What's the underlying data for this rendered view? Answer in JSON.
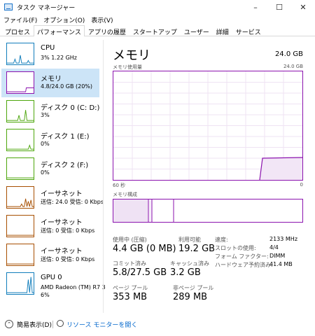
{
  "window": {
    "title": "タスク マネージャー",
    "controls": {
      "minimize": "–",
      "maximize": "☐",
      "close": "✕"
    }
  },
  "menu": [
    "ファイル(F)",
    "オプション(O)",
    "表示(V)"
  ],
  "tabs": [
    "プロセス",
    "パフォーマンス",
    "アプリの履歴",
    "スタートアップ",
    "ユーザー",
    "詳細",
    "サービス"
  ],
  "active_tab_index": 1,
  "sidebar": {
    "items": [
      {
        "name": "CPU",
        "sub": "3%  1.22 GHz",
        "sub2": "",
        "color": "#117dbb",
        "selected": false
      },
      {
        "name": "メモリ",
        "sub": "4.8/24.0 GB (20%)",
        "sub2": "",
        "color": "#8b12ae",
        "selected": true
      },
      {
        "name": "ディスク 0 (C: D:)",
        "sub": "3%",
        "sub2": "",
        "color": "#4da60c",
        "selected": false
      },
      {
        "name": "ディスク 1 (E:)",
        "sub": "0%",
        "sub2": "",
        "color": "#4da60c",
        "selected": false
      },
      {
        "name": "ディスク 2 (F:)",
        "sub": "0%",
        "sub2": "",
        "color": "#4da60c",
        "selected": false
      },
      {
        "name": "イーサネット",
        "sub": "送信: 24.0 受信: 0 Kbps",
        "sub2": "",
        "color": "#a74f01",
        "selected": false
      },
      {
        "name": "イーサネット",
        "sub": "送信: 0 受信: 0 Kbps",
        "sub2": "",
        "color": "#a74f01",
        "selected": false
      },
      {
        "name": "イーサネット",
        "sub": "送信: 0 受信: 0 Kbps",
        "sub2": "",
        "color": "#a74f01",
        "selected": false
      },
      {
        "name": "GPU 0",
        "sub": "AMD Radeon (TM) R7 3",
        "sub2": "6%",
        "color": "#117dbb",
        "selected": false
      }
    ]
  },
  "main": {
    "title": "メモリ",
    "total": "24.0 GB",
    "usage_label": "メモリ使用量",
    "usage_max": "24.0 GB",
    "time_label": "60 秒",
    "zero_label": "0",
    "composition_label": "メモリ構成",
    "accent_color": "#8b12ae"
  },
  "stats": {
    "in_use_label": "使用中 (圧縮)",
    "in_use_value": "4.4 GB (0 MB)",
    "available_label": "利用可能",
    "available_value": "19.2 GB",
    "committed_label": "コミット済み",
    "committed_value": "5.8/27.5 GB",
    "cached_label": "キャッシュ済み",
    "cached_value": "3.2 GB",
    "paged_label": "ページ プール",
    "paged_value": "353 MB",
    "nonpaged_label": "非ページ プール",
    "nonpaged_value": "289 MB"
  },
  "details": [
    {
      "label": "速度:",
      "value": "2133 MHz"
    },
    {
      "label": "スロットの使用:",
      "value": "4/4"
    },
    {
      "label": "フォーム ファクター:",
      "value": "DIMM"
    },
    {
      "label": "ハードウェア予約済み:",
      "value": "41.4 MB"
    }
  ],
  "footer": {
    "fewer_details": "簡易表示(D)",
    "resource_monitor": "リソース モニターを開く"
  }
}
